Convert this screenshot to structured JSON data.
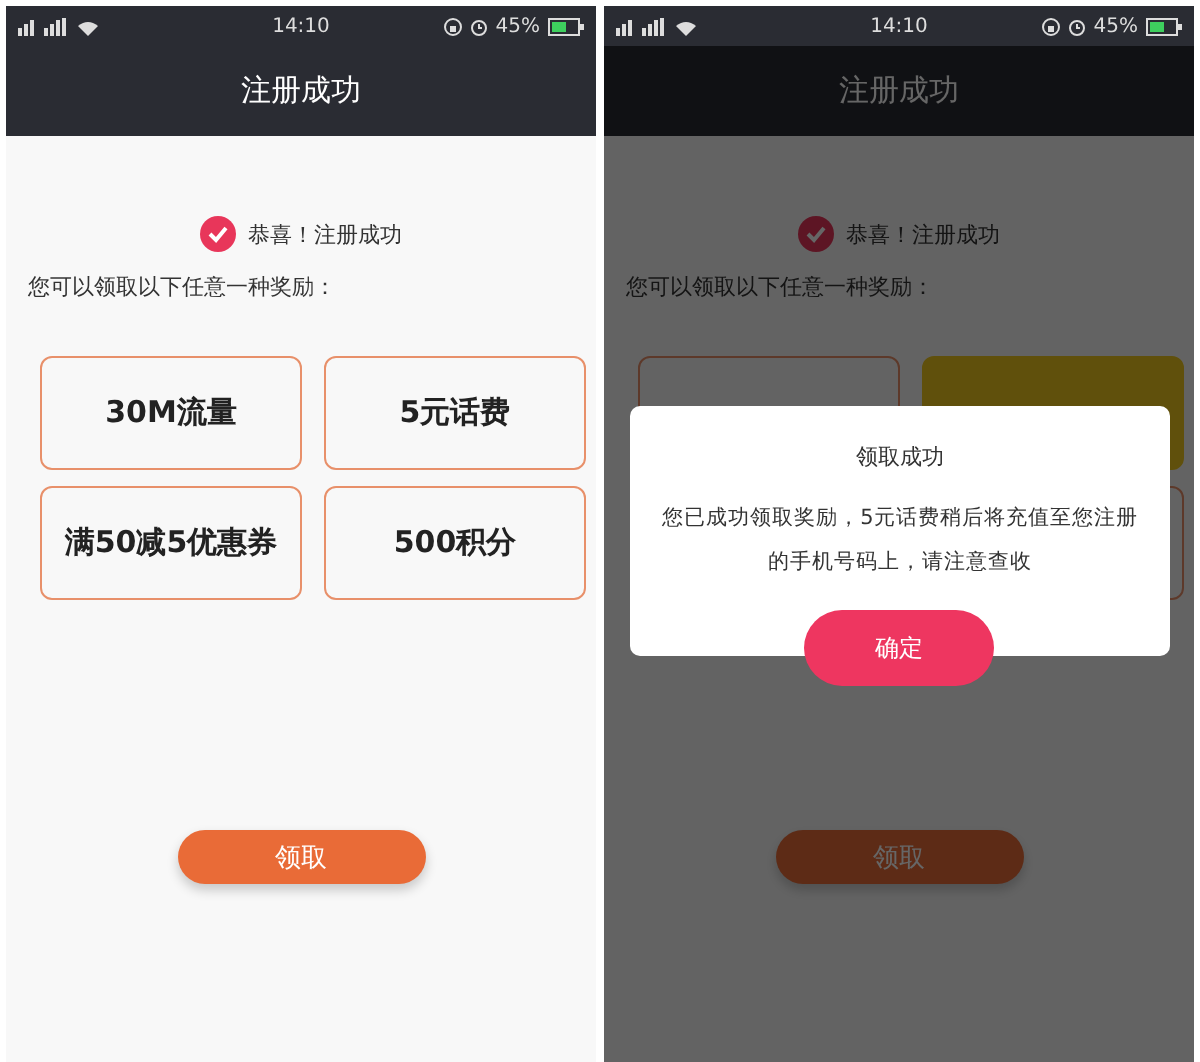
{
  "screens": [
    {
      "status_bar": {
        "time": "14:10",
        "battery": "45%"
      },
      "title": "注册成功",
      "message": "恭喜！注册成功",
      "prompt": "您可以领取以下任意一种奖励：",
      "rewards": [
        {
          "label": "30M流量",
          "selected": false
        },
        {
          "label": "5元话费",
          "selected": false
        },
        {
          "label": "满50减5优惠券",
          "selected": false
        },
        {
          "label": "500积分",
          "selected": false
        }
      ],
      "claim_button": "领取"
    },
    {
      "status_bar": {
        "time": "14:10",
        "battery": "45%"
      },
      "title": "注册成功",
      "message": "恭喜！注册成功",
      "prompt": "您可以领取以下任意一种奖励：",
      "rewards": [
        {
          "selected": false
        },
        {
          "selected": true
        },
        {
          "selected": false
        }
      ],
      "claim_button": "领取",
      "dialog": {
        "title": "领取成功",
        "message": "您已成功领取奖励，5元话费稍后将充值至您注册的手机号码上，请注意查收",
        "confirm_button": "确定"
      }
    }
  ]
}
